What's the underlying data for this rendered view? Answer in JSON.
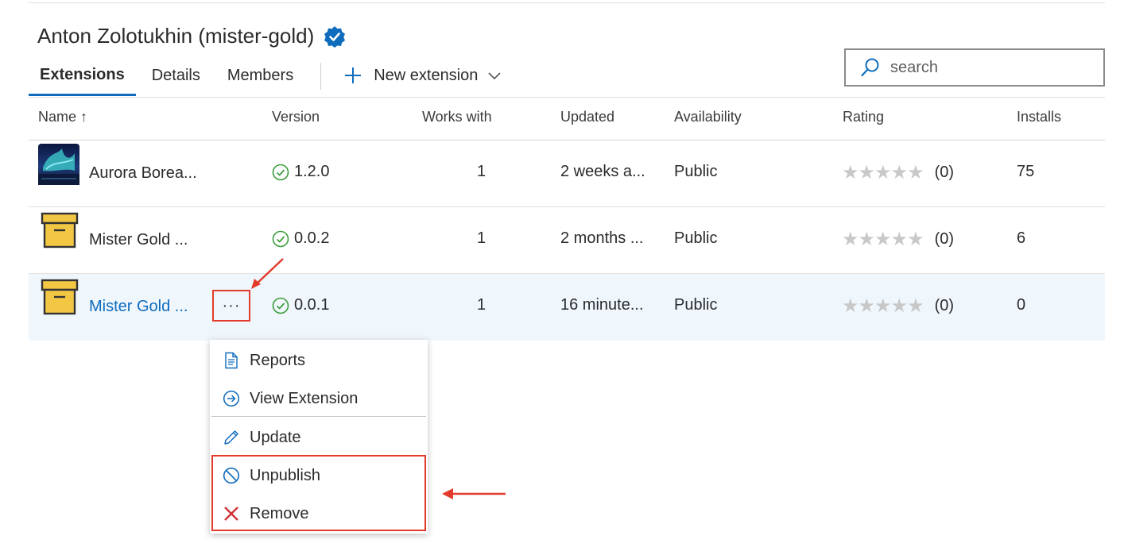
{
  "publisher": {
    "name": "Anton Zolotukhin (mister-gold)"
  },
  "tabs": [
    {
      "label": "Extensions",
      "active": true
    },
    {
      "label": "Details",
      "active": false
    },
    {
      "label": "Members",
      "active": false
    }
  ],
  "new_extension": {
    "label": "New extension"
  },
  "search": {
    "placeholder": "search"
  },
  "columns": {
    "name": "Name ↑",
    "version": "Version",
    "works_with": "Works with",
    "updated": "Updated",
    "availability": "Availability",
    "rating": "Rating",
    "installs": "Installs"
  },
  "rows": [
    {
      "name": "Aurora Borea...",
      "icon": "aurora-icon",
      "version": "1.2.0",
      "works_with": "1",
      "updated": "2 weeks a...",
      "availability": "Public",
      "stars": "★★★★★",
      "rating_count": "(0)",
      "installs": "75"
    },
    {
      "name": "Mister Gold ...",
      "icon": "box-icon",
      "version": "0.0.2",
      "works_with": "1",
      "updated": "2 months ...",
      "availability": "Public",
      "stars": "★★★★★",
      "rating_count": "(0)",
      "installs": "6"
    },
    {
      "name": "Mister Gold ...",
      "icon": "box-icon",
      "version": "0.0.1",
      "works_with": "1",
      "updated": "16 minute...",
      "availability": "Public",
      "stars": "★★★★★",
      "rating_count": "(0)",
      "installs": "0",
      "more_label": "···"
    }
  ],
  "context_menu": {
    "items": [
      {
        "label": "Reports",
        "icon": "document-icon"
      },
      {
        "label": "View Extension",
        "icon": "arrow-circle-icon"
      },
      {
        "label": "Update",
        "icon": "pencil-icon"
      },
      {
        "label": "Unpublish",
        "icon": "block-icon"
      },
      {
        "label": "Remove",
        "icon": "close-icon"
      }
    ]
  },
  "colors": {
    "accent": "#0f6cbd",
    "annotation": "#e23b2b",
    "selected_row": "#eff6fc"
  }
}
